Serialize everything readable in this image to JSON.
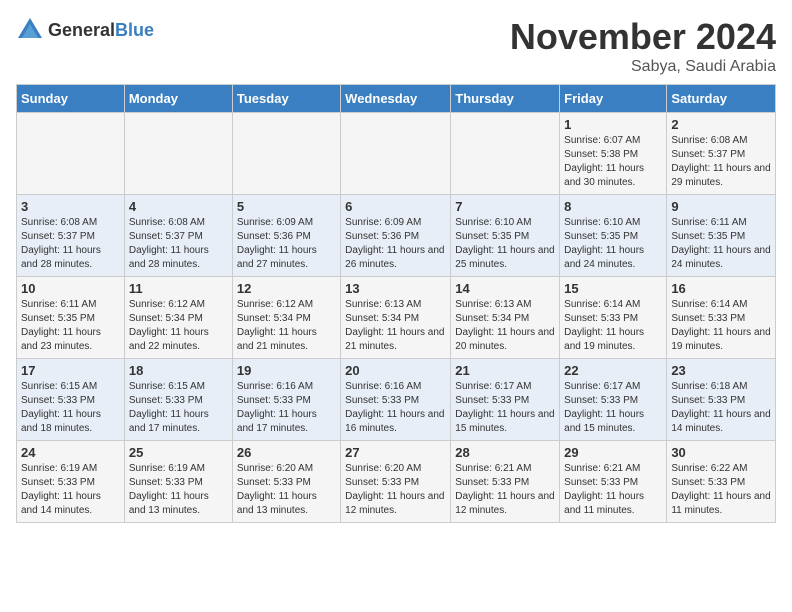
{
  "header": {
    "logo_general": "General",
    "logo_blue": "Blue",
    "month_title": "November 2024",
    "location": "Sabya, Saudi Arabia"
  },
  "days_of_week": [
    "Sunday",
    "Monday",
    "Tuesday",
    "Wednesday",
    "Thursday",
    "Friday",
    "Saturday"
  ],
  "weeks": [
    {
      "days": [
        {
          "number": "",
          "detail": ""
        },
        {
          "number": "",
          "detail": ""
        },
        {
          "number": "",
          "detail": ""
        },
        {
          "number": "",
          "detail": ""
        },
        {
          "number": "",
          "detail": ""
        },
        {
          "number": "1",
          "detail": "Sunrise: 6:07 AM\nSunset: 5:38 PM\nDaylight: 11 hours and 30 minutes."
        },
        {
          "number": "2",
          "detail": "Sunrise: 6:08 AM\nSunset: 5:37 PM\nDaylight: 11 hours and 29 minutes."
        }
      ]
    },
    {
      "days": [
        {
          "number": "3",
          "detail": "Sunrise: 6:08 AM\nSunset: 5:37 PM\nDaylight: 11 hours and 28 minutes."
        },
        {
          "number": "4",
          "detail": "Sunrise: 6:08 AM\nSunset: 5:37 PM\nDaylight: 11 hours and 28 minutes."
        },
        {
          "number": "5",
          "detail": "Sunrise: 6:09 AM\nSunset: 5:36 PM\nDaylight: 11 hours and 27 minutes."
        },
        {
          "number": "6",
          "detail": "Sunrise: 6:09 AM\nSunset: 5:36 PM\nDaylight: 11 hours and 26 minutes."
        },
        {
          "number": "7",
          "detail": "Sunrise: 6:10 AM\nSunset: 5:35 PM\nDaylight: 11 hours and 25 minutes."
        },
        {
          "number": "8",
          "detail": "Sunrise: 6:10 AM\nSunset: 5:35 PM\nDaylight: 11 hours and 24 minutes."
        },
        {
          "number": "9",
          "detail": "Sunrise: 6:11 AM\nSunset: 5:35 PM\nDaylight: 11 hours and 24 minutes."
        }
      ]
    },
    {
      "days": [
        {
          "number": "10",
          "detail": "Sunrise: 6:11 AM\nSunset: 5:35 PM\nDaylight: 11 hours and 23 minutes."
        },
        {
          "number": "11",
          "detail": "Sunrise: 6:12 AM\nSunset: 5:34 PM\nDaylight: 11 hours and 22 minutes."
        },
        {
          "number": "12",
          "detail": "Sunrise: 6:12 AM\nSunset: 5:34 PM\nDaylight: 11 hours and 21 minutes."
        },
        {
          "number": "13",
          "detail": "Sunrise: 6:13 AM\nSunset: 5:34 PM\nDaylight: 11 hours and 21 minutes."
        },
        {
          "number": "14",
          "detail": "Sunrise: 6:13 AM\nSunset: 5:34 PM\nDaylight: 11 hours and 20 minutes."
        },
        {
          "number": "15",
          "detail": "Sunrise: 6:14 AM\nSunset: 5:33 PM\nDaylight: 11 hours and 19 minutes."
        },
        {
          "number": "16",
          "detail": "Sunrise: 6:14 AM\nSunset: 5:33 PM\nDaylight: 11 hours and 19 minutes."
        }
      ]
    },
    {
      "days": [
        {
          "number": "17",
          "detail": "Sunrise: 6:15 AM\nSunset: 5:33 PM\nDaylight: 11 hours and 18 minutes."
        },
        {
          "number": "18",
          "detail": "Sunrise: 6:15 AM\nSunset: 5:33 PM\nDaylight: 11 hours and 17 minutes."
        },
        {
          "number": "19",
          "detail": "Sunrise: 6:16 AM\nSunset: 5:33 PM\nDaylight: 11 hours and 17 minutes."
        },
        {
          "number": "20",
          "detail": "Sunrise: 6:16 AM\nSunset: 5:33 PM\nDaylight: 11 hours and 16 minutes."
        },
        {
          "number": "21",
          "detail": "Sunrise: 6:17 AM\nSunset: 5:33 PM\nDaylight: 11 hours and 15 minutes."
        },
        {
          "number": "22",
          "detail": "Sunrise: 6:17 AM\nSunset: 5:33 PM\nDaylight: 11 hours and 15 minutes."
        },
        {
          "number": "23",
          "detail": "Sunrise: 6:18 AM\nSunset: 5:33 PM\nDaylight: 11 hours and 14 minutes."
        }
      ]
    },
    {
      "days": [
        {
          "number": "24",
          "detail": "Sunrise: 6:19 AM\nSunset: 5:33 PM\nDaylight: 11 hours and 14 minutes."
        },
        {
          "number": "25",
          "detail": "Sunrise: 6:19 AM\nSunset: 5:33 PM\nDaylight: 11 hours and 13 minutes."
        },
        {
          "number": "26",
          "detail": "Sunrise: 6:20 AM\nSunset: 5:33 PM\nDaylight: 11 hours and 13 minutes."
        },
        {
          "number": "27",
          "detail": "Sunrise: 6:20 AM\nSunset: 5:33 PM\nDaylight: 11 hours and 12 minutes."
        },
        {
          "number": "28",
          "detail": "Sunrise: 6:21 AM\nSunset: 5:33 PM\nDaylight: 11 hours and 12 minutes."
        },
        {
          "number": "29",
          "detail": "Sunrise: 6:21 AM\nSunset: 5:33 PM\nDaylight: 11 hours and 11 minutes."
        },
        {
          "number": "30",
          "detail": "Sunrise: 6:22 AM\nSunset: 5:33 PM\nDaylight: 11 hours and 11 minutes."
        }
      ]
    }
  ]
}
